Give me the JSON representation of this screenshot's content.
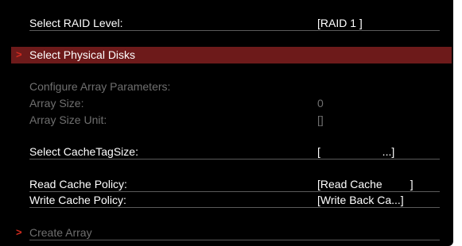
{
  "colors": {
    "background": "#000000",
    "highlight_bar": "#6d1a1a",
    "accent_arrow": "#d42b1f",
    "text_active": "#ffffff",
    "text_disabled": "#6f6f6f"
  },
  "raid_level": {
    "label": "Select RAID Level:",
    "value": "[RAID 1 ]"
  },
  "select_disks": {
    "label": "Select Physical Disks",
    "arrow": ">"
  },
  "array_params": {
    "header": "Configure Array Parameters:",
    "size_label": "Array Size:",
    "size_value": "0",
    "unit_label": "Array Size Unit:",
    "unit_value": "[]"
  },
  "cache_tag": {
    "label": "Select CacheTagSize:",
    "value": "[                    ...]"
  },
  "read_cache": {
    "label": "Read Cache Policy:",
    "value": "[Read Cache         ]"
  },
  "write_cache": {
    "label": "Write Cache Policy:",
    "value": "[Write Back Ca...]"
  },
  "create_array": {
    "label": "Create Array",
    "arrow": ">"
  }
}
